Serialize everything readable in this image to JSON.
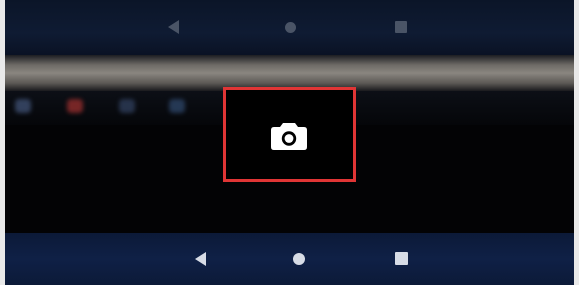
{
  "screen": {
    "top_nav": {
      "back": "back-icon",
      "home": "home-icon",
      "recent": "recent-apps-icon"
    },
    "bottom_nav": {
      "back": "back-icon",
      "home": "home-icon",
      "recent": "recent-apps-icon"
    },
    "highlight": {
      "target": "camera-icon",
      "color": "#e03535"
    }
  }
}
